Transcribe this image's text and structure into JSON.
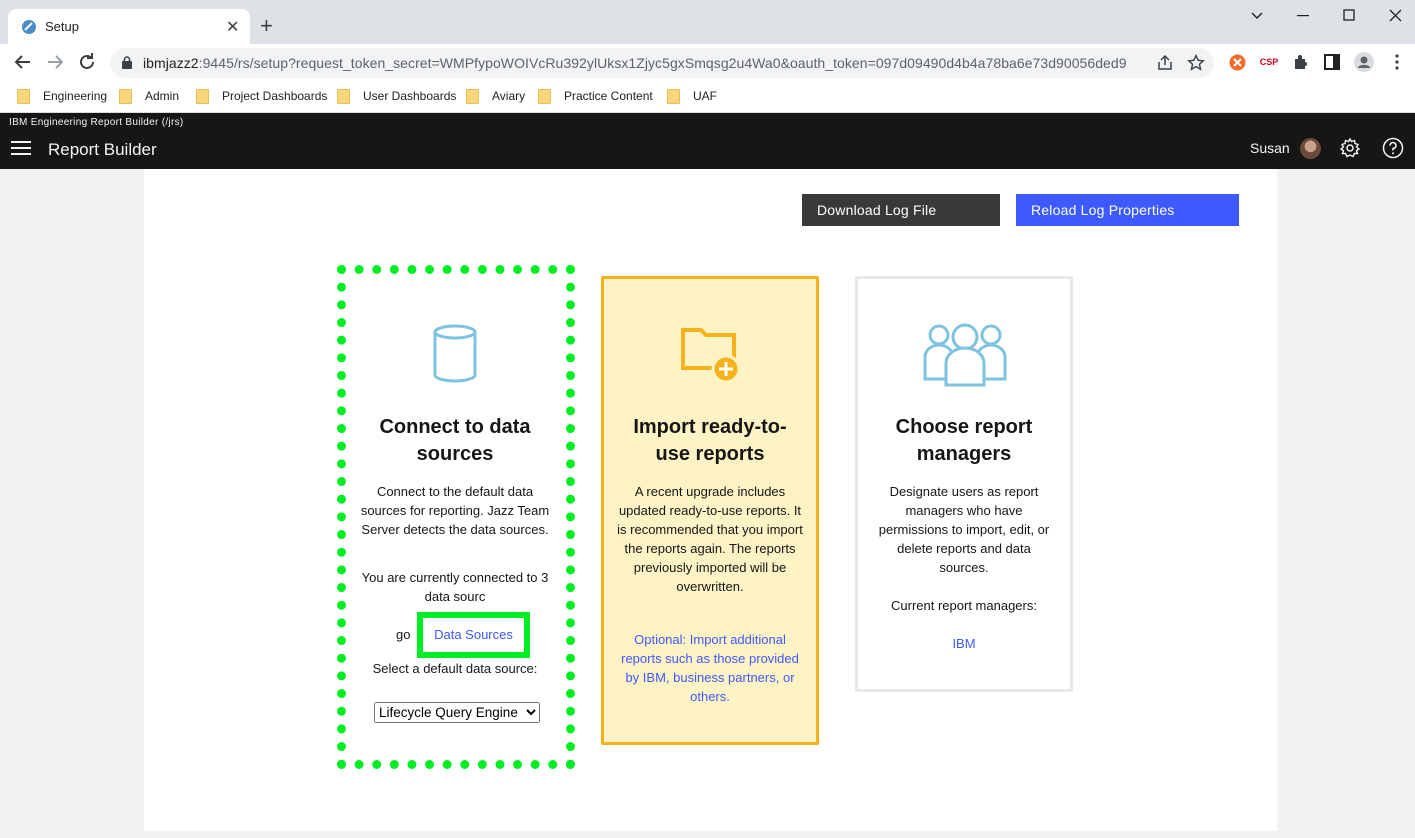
{
  "browser": {
    "tab_title": "Setup",
    "url_host": "ibmjazz2",
    "url_rest": ":9445/rs/setup?request_token_secret=WMPfypoWOIVcRu392ylUksx1Zjyc5gxSmqsg2u4Wa0&oauth_token=097d09490d4b4a78ba6e73d90056ded9",
    "extensions": [
      "orange-extension-icon",
      "csp-extension",
      "puzzle-icon",
      "side-panel-icon",
      "profile-icon"
    ],
    "csp_label": "CSP",
    "bookmarks": [
      "Engineering",
      "Admin",
      "Project Dashboards",
      "User Dashboards",
      "Aviary",
      "Practice Content",
      "UAF"
    ]
  },
  "app": {
    "subtitle": "IBM Engineering Report Builder (/jrs)",
    "title": "Report Builder",
    "user": "Susan"
  },
  "actions": {
    "download_log": "Download Log File",
    "reload_log": "Reload Log Properties"
  },
  "cards": {
    "connect": {
      "title": "Connect to data sources",
      "desc": "Connect to the default data sources for reporting. Jazz Team Server detects the data sources.",
      "status_a": "You are currently connected to 3 data sourc",
      "status_b": "go",
      "link": "Data Sources",
      "select_label": "Select a default data source:",
      "select_value": "Lifecycle Query Engine"
    },
    "import": {
      "title": "Import ready-to-use reports",
      "desc": "A recent upgrade includes updated ready-to-use reports. It is recommended that you import the reports again. The reports previously imported will be overwritten.",
      "optional": "Optional: Import additional reports such as those provided by IBM, business partners, or others."
    },
    "managers": {
      "title": "Choose report managers",
      "desc": "Designate users as report managers who have permissions to import, edit, or delete reports and data sources.",
      "current_label": "Current report managers:",
      "current_value": "IBM"
    }
  },
  "colors": {
    "accent_blue": "#3d5afe",
    "highlight_green": "#00ee22",
    "import_card_bg": "#fdf3c4",
    "import_card_border": "#f5b21a",
    "icon_blue": "#7ec3e0",
    "folder_orange": "#f5b21a"
  }
}
